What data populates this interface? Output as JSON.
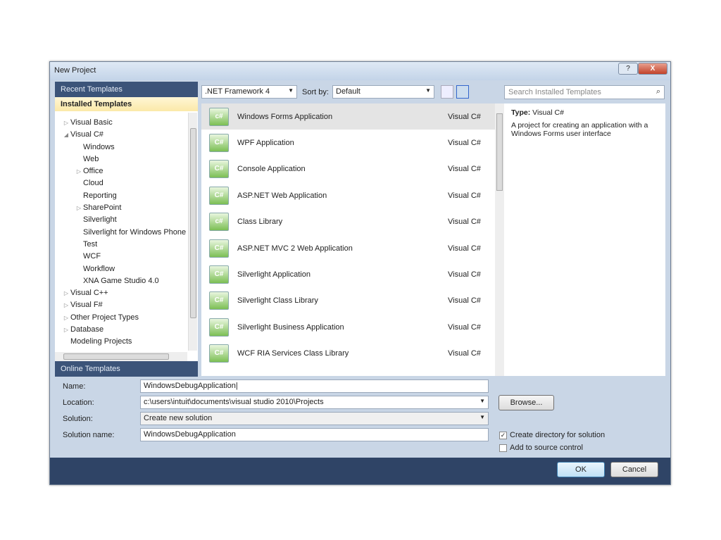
{
  "window": {
    "title": "New Project",
    "help_label": "?",
    "close_label": "X"
  },
  "left": {
    "recent": "Recent Templates",
    "installed": "Installed Templates",
    "online": "Online Templates",
    "tree": [
      {
        "label": "Visual Basic",
        "level": 0,
        "arrow": "▷"
      },
      {
        "label": "Visual C#",
        "level": 0,
        "arrow": "◢"
      },
      {
        "label": "Windows",
        "level": 1,
        "arrow": ""
      },
      {
        "label": "Web",
        "level": 1,
        "arrow": ""
      },
      {
        "label": "Office",
        "level": 1,
        "arrow": "▷"
      },
      {
        "label": "Cloud",
        "level": 1,
        "arrow": ""
      },
      {
        "label": "Reporting",
        "level": 1,
        "arrow": ""
      },
      {
        "label": "SharePoint",
        "level": 1,
        "arrow": "▷"
      },
      {
        "label": "Silverlight",
        "level": 1,
        "arrow": ""
      },
      {
        "label": "Silverlight for Windows Phone",
        "level": 1,
        "arrow": ""
      },
      {
        "label": "Test",
        "level": 1,
        "arrow": ""
      },
      {
        "label": "WCF",
        "level": 1,
        "arrow": ""
      },
      {
        "label": "Workflow",
        "level": 1,
        "arrow": ""
      },
      {
        "label": "XNA Game Studio 4.0",
        "level": 1,
        "arrow": ""
      },
      {
        "label": "Visual C++",
        "level": 0,
        "arrow": "▷"
      },
      {
        "label": "Visual F#",
        "level": 0,
        "arrow": "▷"
      },
      {
        "label": "Other Project Types",
        "level": 0,
        "arrow": "▷"
      },
      {
        "label": "Database",
        "level": 0,
        "arrow": "▷"
      },
      {
        "label": "Modeling Projects",
        "level": 0,
        "arrow": ""
      }
    ]
  },
  "toolbar": {
    "framework": ".NET Framework 4",
    "sort_label": "Sort by:",
    "sort_value": "Default"
  },
  "templates": [
    {
      "name": "Windows Forms Application",
      "lang": "Visual C#",
      "icon": "c#"
    },
    {
      "name": "WPF Application",
      "lang": "Visual C#",
      "icon": "C#"
    },
    {
      "name": "Console Application",
      "lang": "Visual C#",
      "icon": "C#"
    },
    {
      "name": "ASP.NET Web Application",
      "lang": "Visual C#",
      "icon": "C#"
    },
    {
      "name": "Class Library",
      "lang": "Visual C#",
      "icon": "c#"
    },
    {
      "name": "ASP.NET MVC 2 Web Application",
      "lang": "Visual C#",
      "icon": "C#"
    },
    {
      "name": "Silverlight Application",
      "lang": "Visual C#",
      "icon": "C#"
    },
    {
      "name": "Silverlight Class Library",
      "lang": "Visual C#",
      "icon": "C#"
    },
    {
      "name": "Silverlight Business Application",
      "lang": "Visual C#",
      "icon": "C#"
    },
    {
      "name": "WCF RIA Services Class Library",
      "lang": "Visual C#",
      "icon": "C#"
    }
  ],
  "search": {
    "placeholder": "Search Installed Templates"
  },
  "info": {
    "type_label": "Type:",
    "type_value": "Visual C#",
    "description": "A project for creating an application with a Windows Forms user interface"
  },
  "form": {
    "name_label": "Name:",
    "name_value": "WindowsDebugApplication",
    "location_label": "Location:",
    "location_value": "c:\\users\\intuit\\documents\\visual studio 2010\\Projects",
    "solution_label": "Solution:",
    "solution_value": "Create new solution",
    "solution_name_label": "Solution name:",
    "solution_name_value": "WindowsDebugApplication",
    "browse": "Browse...",
    "create_dir": "Create directory for solution",
    "create_dir_checked": true,
    "source_control": "Add to source control",
    "source_control_checked": false,
    "ok": "OK",
    "cancel": "Cancel"
  }
}
